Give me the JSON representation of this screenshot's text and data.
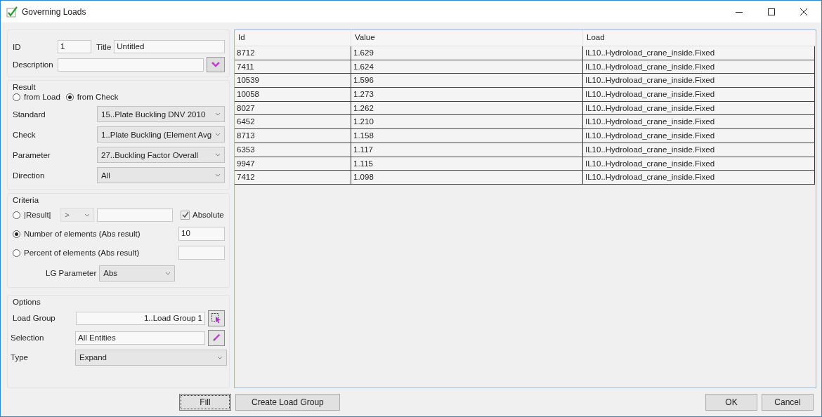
{
  "window": {
    "title": "Governing Loads"
  },
  "general": {
    "id_label": "ID",
    "id": "1",
    "title_label": "Title",
    "title": "Untitled",
    "description_label": "Description"
  },
  "result": {
    "heading": "Result",
    "sources": [
      {
        "label": "from Load",
        "selected": false
      },
      {
        "label": "from Check",
        "selected": true
      }
    ],
    "fields": [
      {
        "label": "Standard",
        "value": "15..Plate Buckling DNV 2010"
      },
      {
        "label": "Check",
        "value": "1..Plate Buckling (Element Avg"
      },
      {
        "label": "Parameter",
        "value": "27..Buckling Factor Overall"
      },
      {
        "label": "Direction",
        "value": "All"
      }
    ]
  },
  "criteria": {
    "heading": "Criteria",
    "modes": [
      {
        "kind": "threshold",
        "label": "|Result|",
        "selected": false,
        "operator": ">",
        "operator_disabled": true,
        "absolute": {
          "label": "Absolute",
          "checked": true
        }
      },
      {
        "kind": "count",
        "label": "Number of elements (Abs result)",
        "selected": true,
        "value": "10"
      },
      {
        "kind": "count",
        "label": "Percent of elements (Abs result)",
        "selected": false
      }
    ],
    "lg_parameter": {
      "label": "LG Parameter",
      "value": "Abs"
    }
  },
  "options": {
    "heading": "Options",
    "load_group": {
      "label": "Load Group",
      "value": "1..Load Group 1"
    },
    "selection": {
      "label": "Selection",
      "value": "All Entities"
    },
    "type": {
      "label": "Type",
      "value": "Expand"
    }
  },
  "table": {
    "columns": [
      "Id",
      "Value",
      "Load"
    ],
    "rows": [
      [
        "8712",
        "1.629",
        "IL10..Hydroload_crane_inside.Fixed"
      ],
      [
        "7411",
        "1.624",
        "IL10..Hydroload_crane_inside.Fixed"
      ],
      [
        "10539",
        "1.596",
        "IL10..Hydroload_crane_inside.Fixed"
      ],
      [
        "10058",
        "1.273",
        "IL10..Hydroload_crane_inside.Fixed"
      ],
      [
        "8027",
        "1.262",
        "IL10..Hydroload_crane_inside.Fixed"
      ],
      [
        "6452",
        "1.210",
        "IL10..Hydroload_crane_inside.Fixed"
      ],
      [
        "8713",
        "1.158",
        "IL10..Hydroload_crane_inside.Fixed"
      ],
      [
        "6353",
        "1.117",
        "IL10..Hydroload_crane_inside.Fixed"
      ],
      [
        "9947",
        "1.115",
        "IL10..Hydroload_crane_inside.Fixed"
      ],
      [
        "7412",
        "1.098",
        "IL10..Hydroload_crane_inside.Fixed"
      ]
    ]
  },
  "buttons_left": [
    {
      "label": "Fill",
      "focused": true
    },
    {
      "label": "Create Load Group",
      "focused": false
    }
  ],
  "buttons_right": [
    {
      "label": "OK",
      "focused": false
    },
    {
      "label": "Cancel",
      "focused": false
    }
  ]
}
